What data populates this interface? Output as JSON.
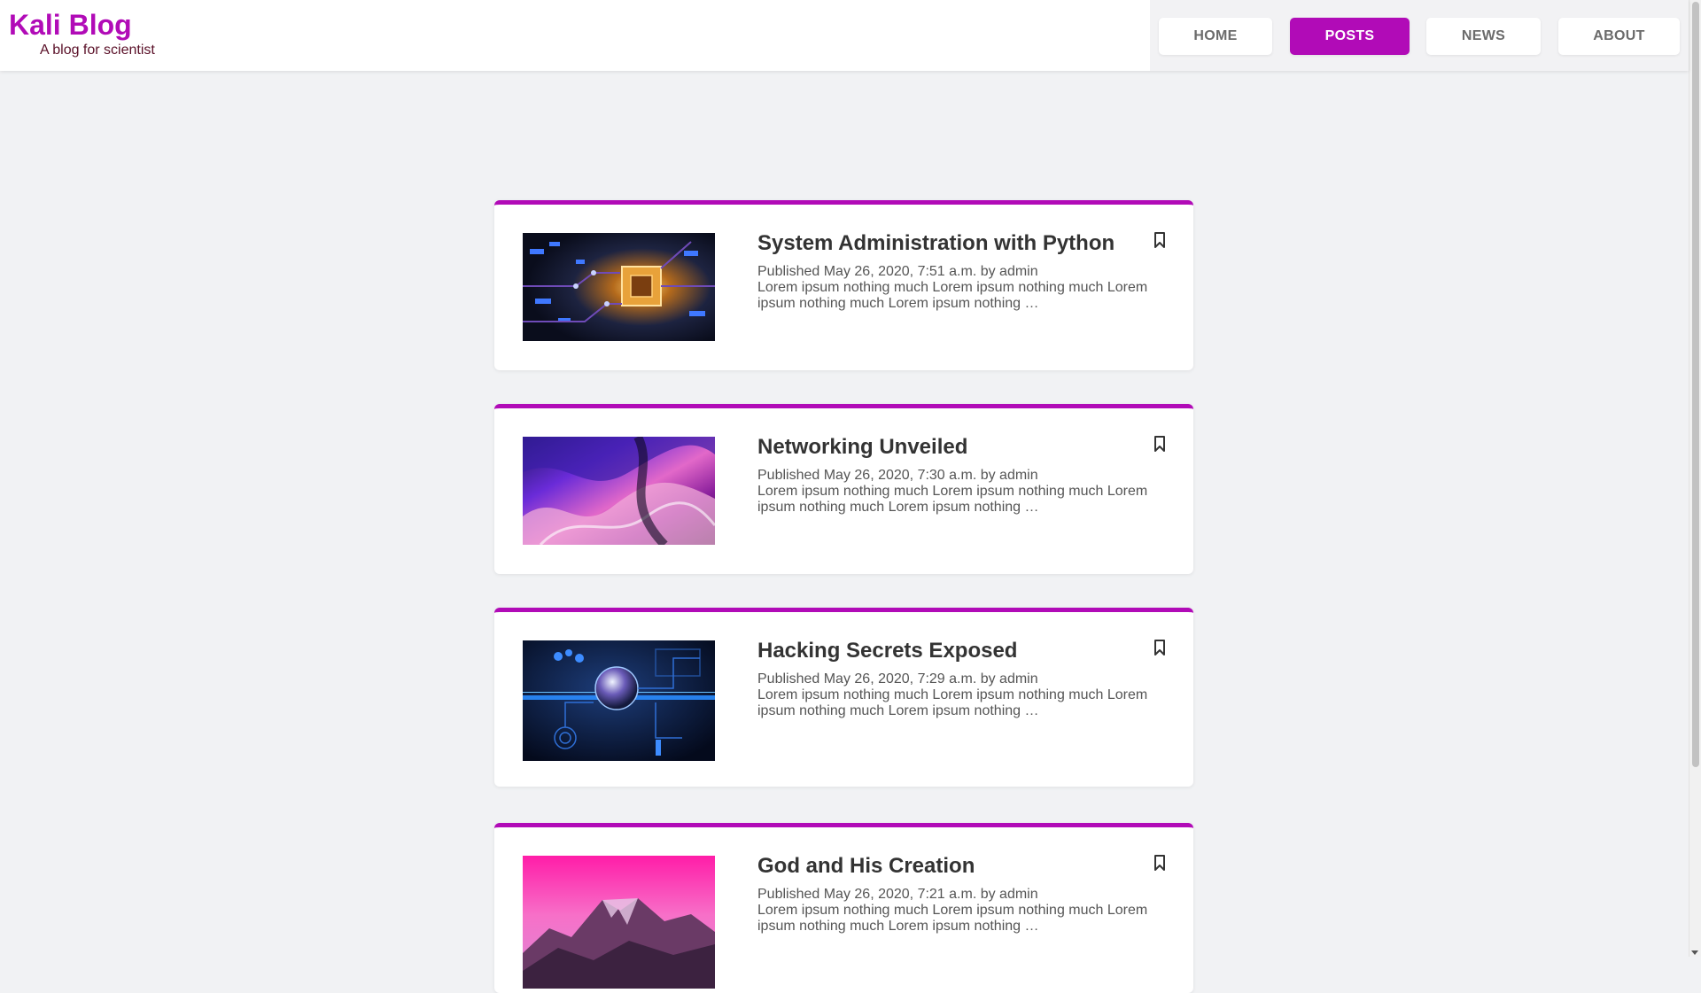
{
  "brand": {
    "title": "Kali Blog",
    "tagline": "A blog for scientist"
  },
  "nav": {
    "items": [
      {
        "label": "HOME",
        "active": false
      },
      {
        "label": "POSTS",
        "active": true
      },
      {
        "label": "NEWS",
        "active": false
      },
      {
        "label": "ABOUT",
        "active": false
      }
    ]
  },
  "colors": {
    "accent": "#b10bb7",
    "page_background": "#f1f2f4",
    "tagline": "#5a1028"
  },
  "posts": [
    {
      "title": "System Administration with Python",
      "meta": "Published May 26, 2020, 7:51 a.m. by admin",
      "excerpt": "Lorem ipsum nothing much Lorem ipsum nothing much Lorem ipsum nothing much Lorem ipsum nothing …",
      "image": "circuit-board-cpu-image",
      "bookmark_icon": "bookmark-icon"
    },
    {
      "title": "Networking Unveiled",
      "meta": "Published May 26, 2020, 7:30 a.m. by admin",
      "excerpt": "Lorem ipsum nothing much Lorem ipsum nothing much Lorem ipsum nothing much Lorem ipsum nothing …",
      "image": "abstract-fluid-purple-image",
      "bookmark_icon": "bookmark-icon"
    },
    {
      "title": "Hacking Secrets Exposed",
      "meta": "Published May 26, 2020, 7:29 a.m. by admin",
      "excerpt": "Lorem ipsum nothing much Lorem ipsum nothing much Lorem ipsum nothing much Lorem ipsum nothing …",
      "image": "digital-tech-sphere-image",
      "bookmark_icon": "bookmark-icon"
    },
    {
      "title": "God and His Creation",
      "meta": "Published May 26, 2020, 7:21 a.m. by admin",
      "excerpt": "Lorem ipsum nothing much Lorem ipsum nothing much Lorem ipsum nothing much Lorem ipsum nothing …",
      "image": "pink-mountain-sunset-image",
      "bookmark_icon": "bookmark-icon"
    }
  ]
}
